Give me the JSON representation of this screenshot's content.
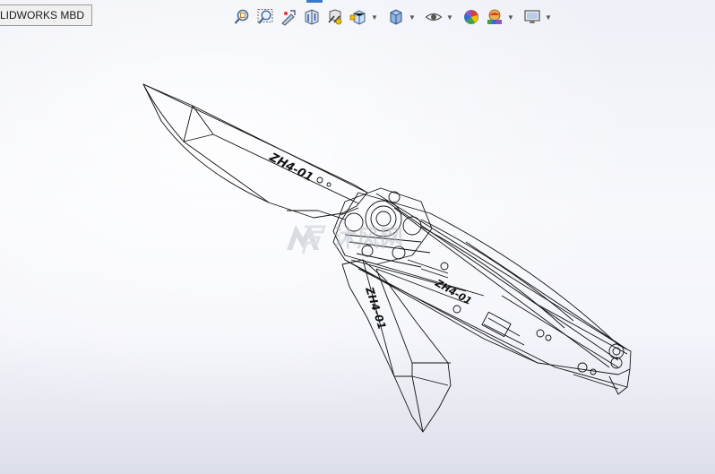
{
  "tab": {
    "label": "LIDWORKS MBD"
  },
  "toolbar": {
    "tools": [
      {
        "name": "zoom-to-fit-icon"
      },
      {
        "name": "zoom-to-area-icon"
      },
      {
        "name": "previous-view-icon"
      },
      {
        "name": "section-view-icon"
      },
      {
        "name": "dynamic-annotation-icon"
      },
      {
        "name": "view-orientation-icon"
      },
      {
        "name": "display-style-icon"
      },
      {
        "name": "hide-show-items-icon"
      },
      {
        "name": "edit-appearance-icon"
      },
      {
        "name": "apply-scene-icon"
      },
      {
        "name": "view-settings-icon"
      }
    ]
  },
  "watermark": {
    "text": "沐风网"
  },
  "model": {
    "blade_text": "ZH4-01"
  }
}
